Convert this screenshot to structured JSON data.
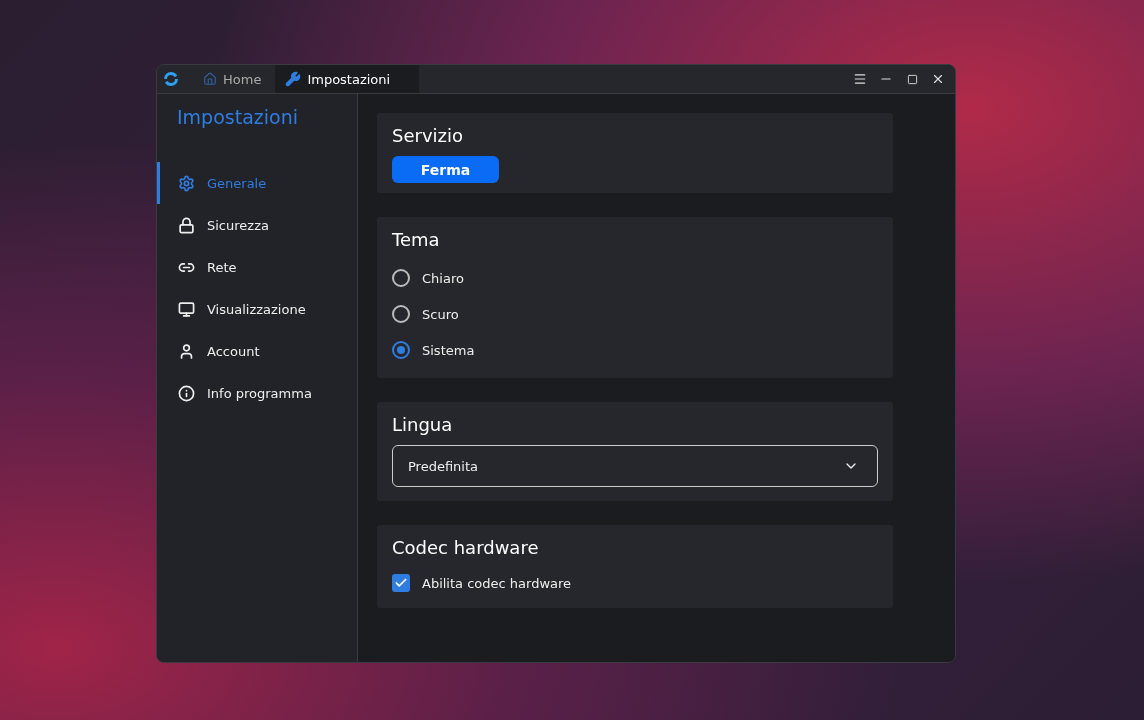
{
  "tabs": [
    {
      "label": "Home",
      "selected": false
    },
    {
      "label": "Impostazioni",
      "selected": true
    }
  ],
  "sidebar": {
    "title": "Impostazioni",
    "items": [
      {
        "label": "Generale",
        "selected": true
      },
      {
        "label": "Sicurezza",
        "selected": false
      },
      {
        "label": "Rete",
        "selected": false
      },
      {
        "label": "Visualizzazione",
        "selected": false
      },
      {
        "label": "Account",
        "selected": false
      },
      {
        "label": "Info programma",
        "selected": false
      }
    ]
  },
  "sections": [
    {
      "kind": "button",
      "title": "Servizio",
      "button": "Ferma"
    },
    {
      "kind": "radios",
      "title": "Tema",
      "options": [
        {
          "label": "Chiaro",
          "selected": false
        },
        {
          "label": "Scuro",
          "selected": false
        },
        {
          "label": "Sistema",
          "selected": true
        }
      ]
    },
    {
      "kind": "select",
      "title": "Lingua",
      "value": "Predefinita"
    },
    {
      "kind": "checkbox",
      "title": "Codec hardware",
      "label": "Abilita codec hardware",
      "checked": true
    }
  ]
}
